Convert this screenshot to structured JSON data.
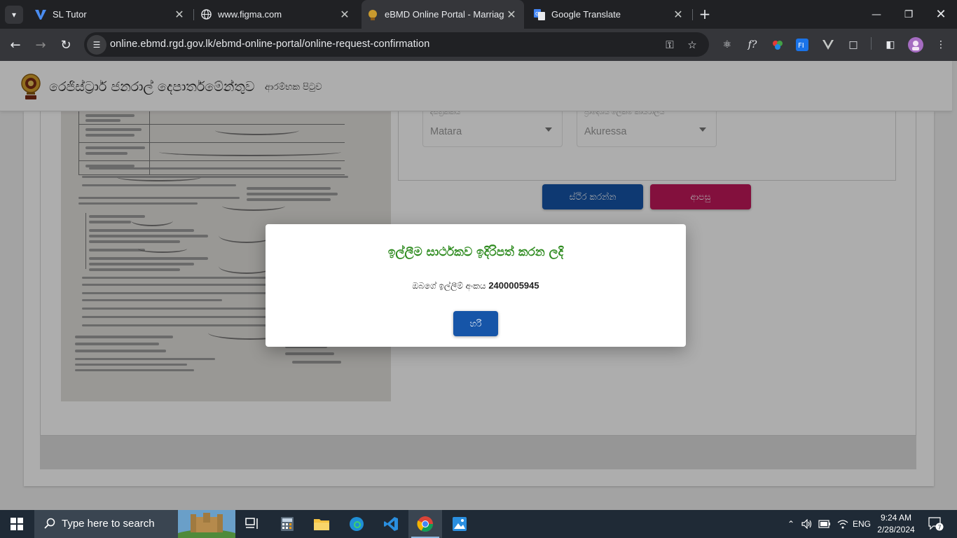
{
  "browser": {
    "tabs": [
      {
        "label": "SL Tutor"
      },
      {
        "label": "www.figma.com"
      },
      {
        "label": "eBMD Online Portal - Marriage"
      },
      {
        "label": "Google Translate"
      }
    ],
    "active_tab": 2,
    "url": "online.ebmd.rgd.gov.lk/ebmd-online-portal/online-request-confirmation"
  },
  "site": {
    "title": "රෙජිස්ට්‍රාර් ජනරාල් දෙපාර්තමේන්තුව",
    "nav_home": "ආරම්භක පිටුව"
  },
  "form": {
    "district": {
      "label": "දිස්ත්‍රික්කය",
      "value": "Matara"
    },
    "office": {
      "label": "ප්‍රාදේශීය ලේකම් කාර්යාලය",
      "value": "Akuressa"
    },
    "confirm_label": "ස්ථිර කරන්න",
    "back_label": "ආපසු"
  },
  "modal": {
    "title": "ඉල්ලීම සාර්ථකව ඉදිරිපත් කරන ලදි",
    "message": "ඔබගේ ඉල්ලීම් අංකය",
    "request_number": "2400005945",
    "ok_label": "හරි"
  },
  "taskbar": {
    "search_placeholder": "Type here to search",
    "language": "ENG",
    "time": "9:24 AM",
    "date": "2/28/2024",
    "notification_count": "7"
  },
  "colors": {
    "primary": "#1655a8",
    "accent": "#c2185b",
    "success": "#2e8b1f"
  }
}
